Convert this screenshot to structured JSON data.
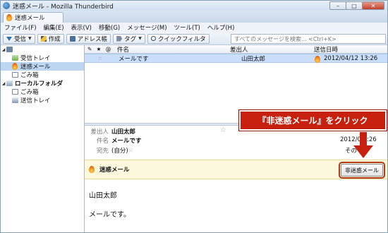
{
  "window": {
    "title": "迷惑メール - Mozilla Thunderbird",
    "controls": [
      "–",
      "□",
      "✕"
    ]
  },
  "tab": {
    "label": "迷惑メール"
  },
  "menubar": [
    "ファイル(F)",
    "編集(E)",
    "表示(V)",
    "移動(G)",
    "メッセージ(M)",
    "ツール(T)",
    "ヘルプ(H)"
  ],
  "toolbar": {
    "receive": "受信",
    "compose": "作成",
    "addressbook": "アドレス帳",
    "tag": "タグ",
    "quickfilter": "クイックフィルタ",
    "search_placeholder": "すべてのメッセージを検索... <Ctrl+K>"
  },
  "folders": {
    "account_name": "",
    "account_items": [
      "受信トレイ",
      "迷惑メール",
      "ごみ箱"
    ],
    "local_label": "ローカルフォルダ",
    "local_items": [
      "ごみ箱",
      "送信トレイ"
    ]
  },
  "thread": {
    "symbols": "✎ ★ @",
    "columns": {
      "subject": "件名",
      "from": "差出人",
      "date": "送信日時"
    },
    "row": {
      "star": "☆",
      "subject": "メールです",
      "from": "山田太郎",
      "date": "2012/04/12 13:26"
    }
  },
  "header": {
    "from_label": "差出人",
    "from": "山田太郎",
    "subject_label": "件名",
    "subject": "メールです",
    "to_label": "宛先",
    "to": "(自分)",
    "date": "2012/0   3:26",
    "other": "その"
  },
  "junkbar": {
    "text": "迷惑メール",
    "button": "非迷惑メール"
  },
  "body": {
    "line1": "山田太郎",
    "line2": "メールです。"
  },
  "callout": {
    "text": "『非迷惑メール』をクリック"
  }
}
